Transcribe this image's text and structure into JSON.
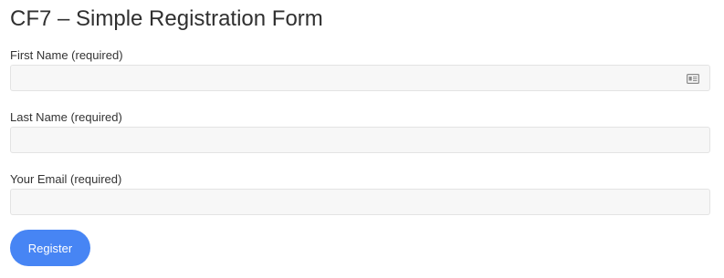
{
  "form": {
    "title": "CF7 – Simple Registration Form",
    "fields": [
      {
        "label": "First Name (required)",
        "value": "",
        "icon": "contact-card-icon"
      },
      {
        "label": "Last Name (required)",
        "value": ""
      },
      {
        "label": "Your Email (required)",
        "value": ""
      }
    ],
    "submit_label": "Register"
  },
  "colors": {
    "button": "#4785f4",
    "input_background": "#f7f7f7",
    "input_border": "#e3e3e3",
    "title": "#303030",
    "text": "#333333"
  }
}
